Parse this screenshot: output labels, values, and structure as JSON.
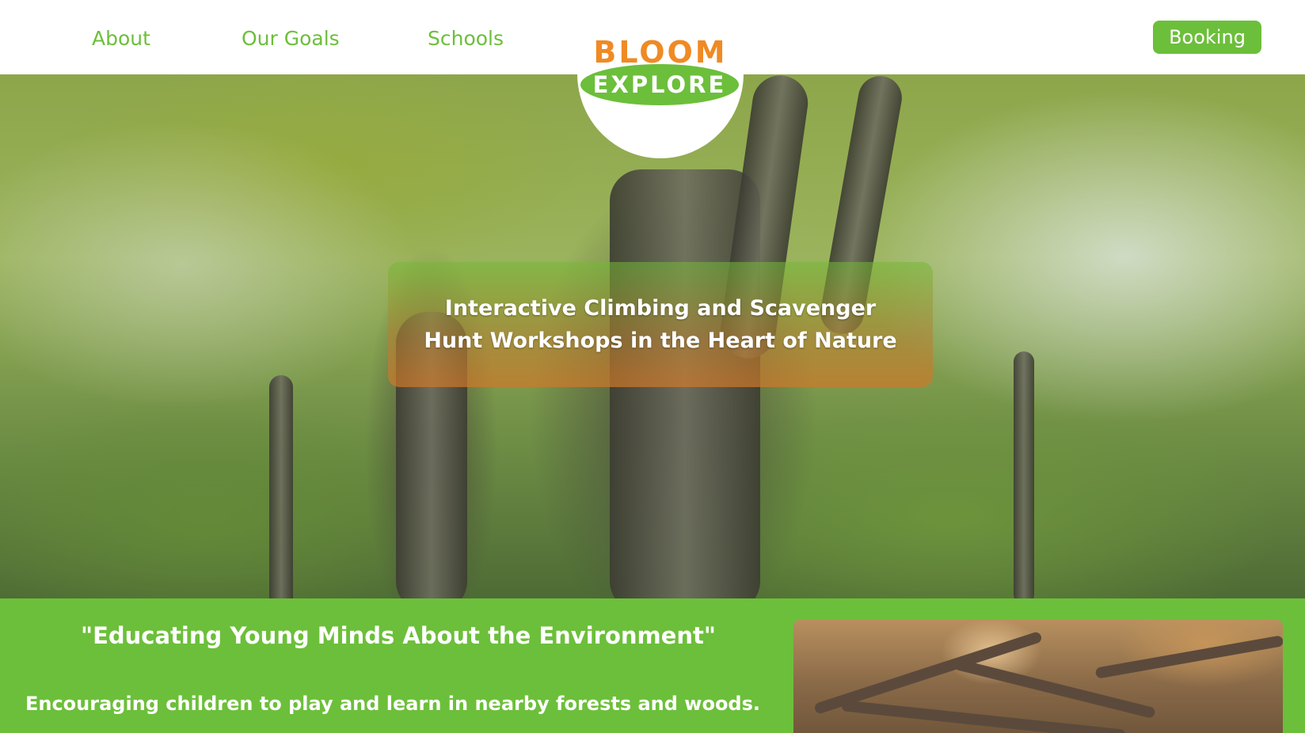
{
  "nav": {
    "about": "About",
    "goals": "Our Goals",
    "schools": "Schools",
    "booking": "Booking"
  },
  "logo": {
    "top": "BLOOM",
    "bottom": "EXPLORE"
  },
  "hero": {
    "caption": "Interactive Climbing and Scavenger\nHunt Workshops in the Heart of Nature"
  },
  "band": {
    "title": "\"Educating Young Minds About the Environment\"",
    "subtitle": "Encouraging children to play and learn in nearby forests and woods."
  },
  "colors": {
    "brand_green": "#6cbf3a",
    "brand_orange": "#f08a24"
  }
}
